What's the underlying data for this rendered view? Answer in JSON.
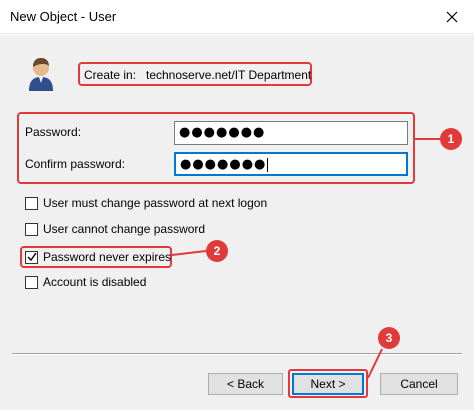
{
  "window": {
    "title": "New Object - User",
    "close_glyph": "✕"
  },
  "create_in": {
    "label": "Create in:",
    "path": "technoserve.net/IT Department"
  },
  "password": {
    "label": "Password:",
    "value": "●●●●●●●"
  },
  "confirm": {
    "label": "Confirm password:",
    "value": "●●●●●●●"
  },
  "options": [
    {
      "label": "User must change password at next logon",
      "checked": false
    },
    {
      "label": "User cannot change password",
      "checked": false
    },
    {
      "label": "Password never expires",
      "checked": true
    },
    {
      "label": "Account is disabled",
      "checked": false
    }
  ],
  "buttons": {
    "back": "< Back",
    "next": "Next >",
    "cancel": "Cancel"
  },
  "annotations": {
    "one": "1",
    "two": "2",
    "three": "3"
  },
  "colors": {
    "highlight": "#e03a3a",
    "focus": "#0078d7",
    "dialog_bg": "#f0f0f0"
  }
}
